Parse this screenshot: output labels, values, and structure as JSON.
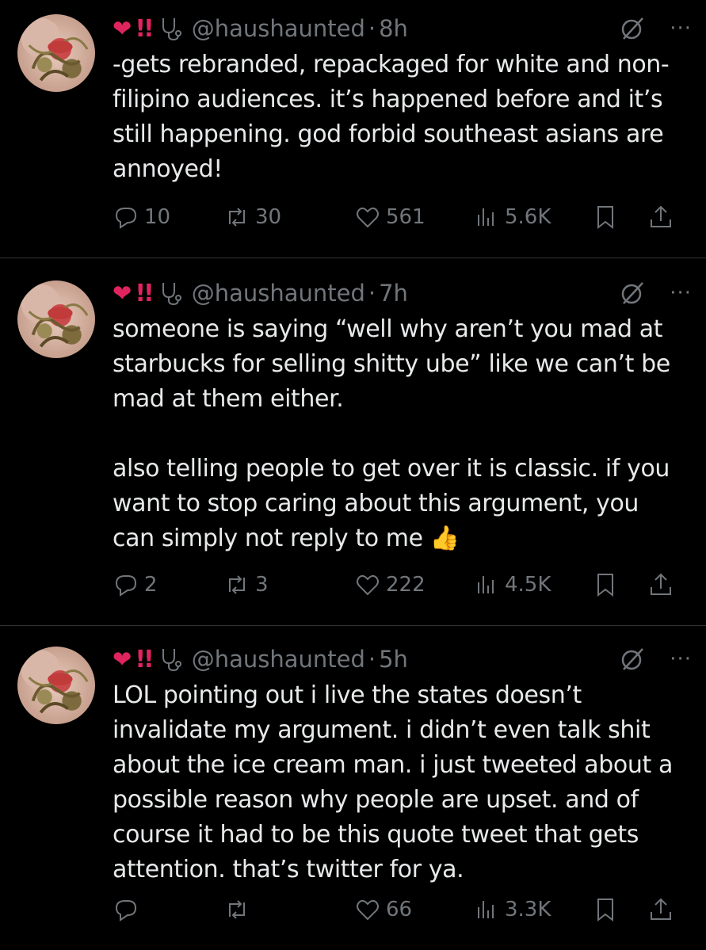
{
  "tweets": [
    {
      "handle": "@haushaunted",
      "time": "8h",
      "text": "-gets rebranded, repackaged for white and non-filipino audiences. it’s happened before and it’s still happening. god forbid southeast asians are annoyed!",
      "replies": "10",
      "retweets": "30",
      "likes": "561",
      "views": "5.6K"
    },
    {
      "handle": "@haushaunted",
      "time": "7h",
      "text": "someone is saying “well why aren’t you mad at starbucks for selling shitty ube” like we can’t be mad at them either.\n\nalso telling people to get over it is classic. if you want to stop caring about this argument, you can simply not reply to me",
      "emoji": "👍",
      "replies": "2",
      "retweets": "3",
      "likes": "222",
      "views": "4.5K"
    },
    {
      "handle": "@haushaunted",
      "time": "5h",
      "text": "LOL pointing out i live the states doesn’t invalidate my argument. i didn’t even talk shit about the ice cream man. i just tweeted about a possible reason why people are upset. and of course it had to be this quote tweet that gets attention. that’s twitter for ya.",
      "replies": "",
      "retweets": "",
      "likes": "66",
      "views": "3.3K"
    }
  ],
  "display_name_glyphs": {
    "heart": "❤",
    "bang": "!!"
  },
  "separator": "·",
  "more_glyph": "···",
  "icons": [
    "reply-icon",
    "retweet-icon",
    "like-icon",
    "views-icon",
    "bookmark-icon",
    "share-icon",
    "grok-icon",
    "more-icon",
    "stethoscope-icon"
  ],
  "colors": {
    "background": "#000000",
    "text": "#e7e9ea",
    "muted": "#71767b",
    "heart": "#e0245e",
    "divider": "#2f3336"
  }
}
